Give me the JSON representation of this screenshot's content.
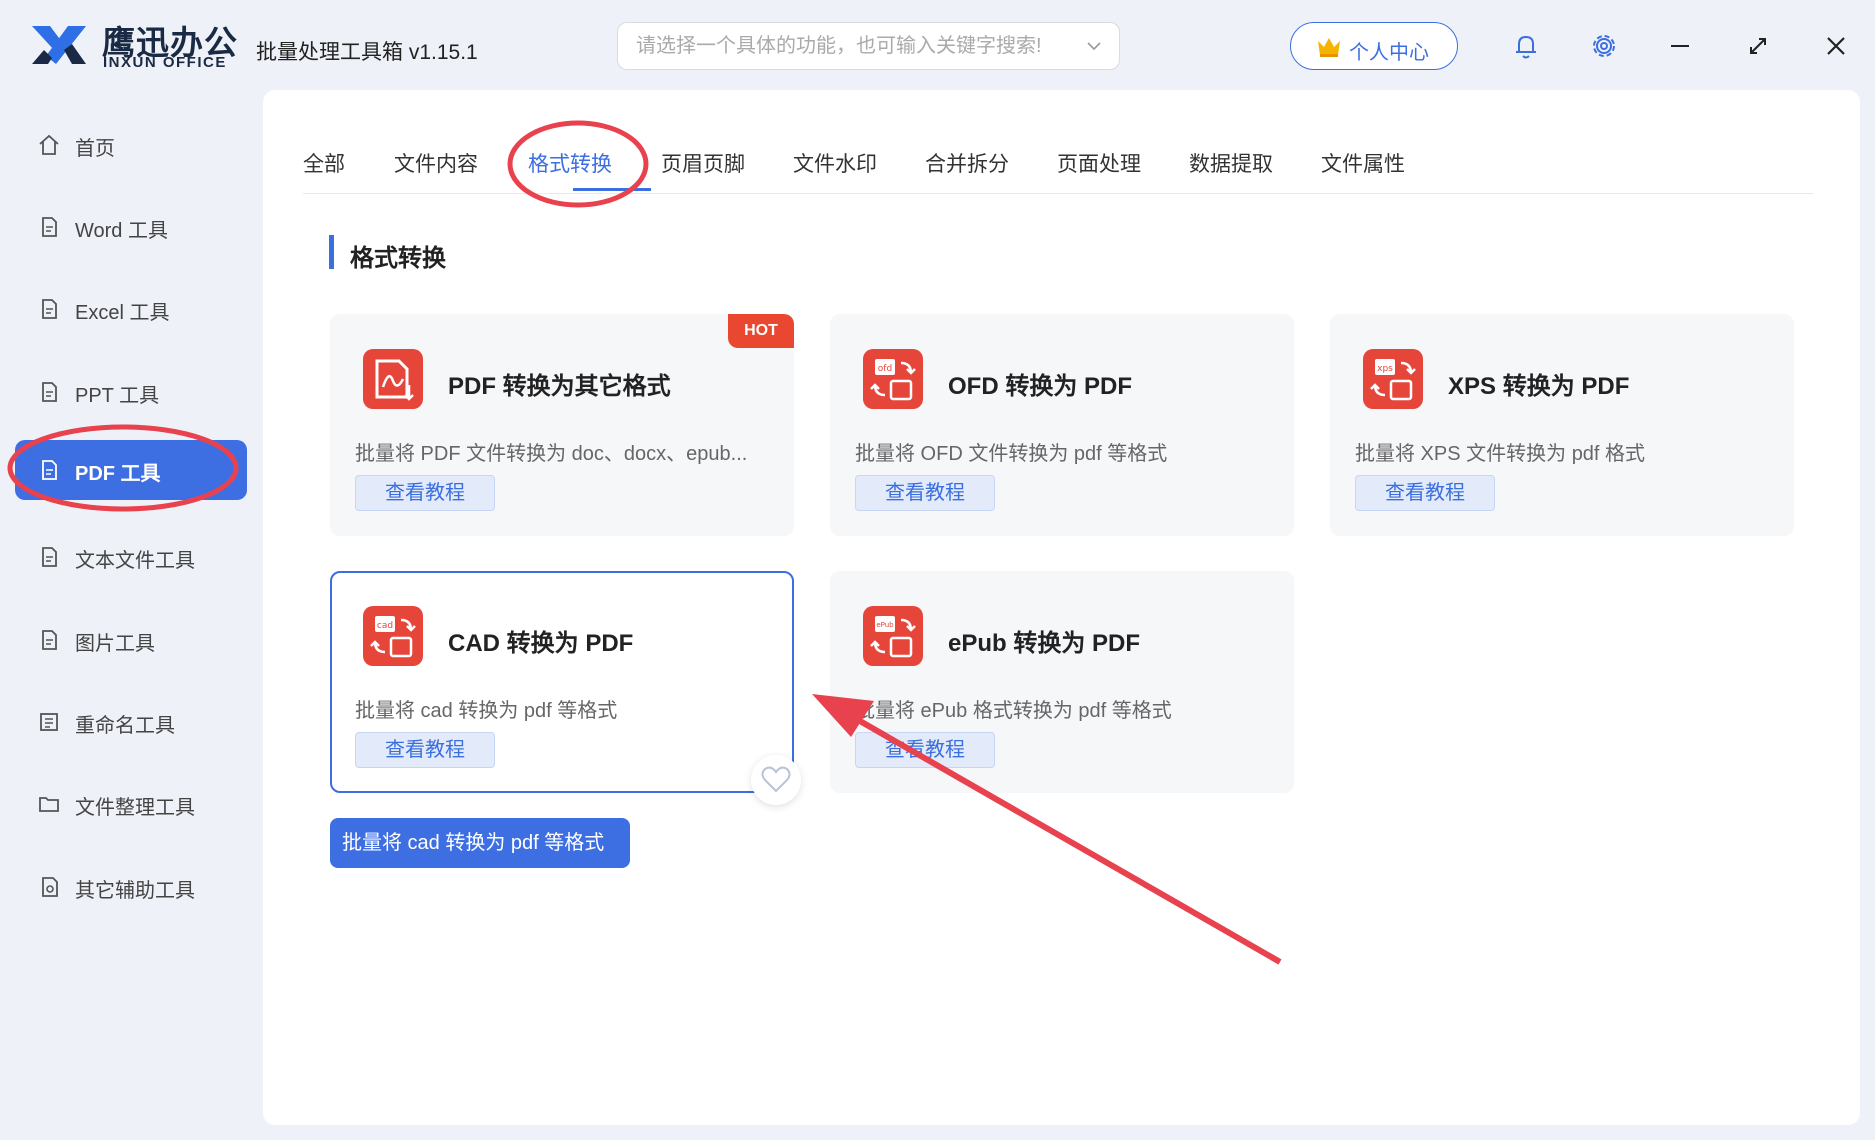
{
  "titlebar": {
    "brand_cn": "鹰迅办公",
    "brand_en": "INXUN OFFICE",
    "app_title": "批量处理工具箱 v1.15.1",
    "search_placeholder": "请选择一个具体的功能，也可输入关键字搜索!",
    "user_center": "个人中心",
    "icons": [
      "bell-icon",
      "gear-icon",
      "minimize-icon",
      "maximize-icon",
      "close-icon"
    ]
  },
  "sidebar": {
    "items": [
      {
        "label": "首页",
        "icon": "home-icon"
      },
      {
        "label": "Word 工具",
        "icon": "word-file-icon"
      },
      {
        "label": "Excel 工具",
        "icon": "excel-file-icon"
      },
      {
        "label": "PPT 工具",
        "icon": "ppt-file-icon"
      },
      {
        "label": "PDF 工具",
        "icon": "pdf-file-icon",
        "active": true
      },
      {
        "label": "文本文件工具",
        "icon": "text-file-icon"
      },
      {
        "label": "图片工具",
        "icon": "image-file-icon"
      },
      {
        "label": "重命名工具",
        "icon": "rename-icon"
      },
      {
        "label": "文件整理工具",
        "icon": "folder-icon"
      },
      {
        "label": "其它辅助工具",
        "icon": "tools-icon"
      }
    ]
  },
  "tabs": [
    {
      "label": "全部"
    },
    {
      "label": "文件内容"
    },
    {
      "label": "格式转换",
      "active": true
    },
    {
      "label": "页眉页脚"
    },
    {
      "label": "文件水印"
    },
    {
      "label": "合并拆分"
    },
    {
      "label": "页面处理"
    },
    {
      "label": "数据提取"
    },
    {
      "label": "文件属性"
    }
  ],
  "section_title": "格式转换",
  "cards": [
    {
      "title": "PDF 转换为其它格式",
      "desc": "批量将 PDF 文件转换为 doc、docx、epub...",
      "button": "查看教程",
      "badge": "HOT",
      "icon": "pdf-convert-icon"
    },
    {
      "title": "OFD 转换为 PDF",
      "desc": "批量将 OFD 文件转换为 pdf 等格式",
      "button": "查看教程",
      "icon": "ofd-convert-icon",
      "icon_text": "ofd"
    },
    {
      "title": "XPS 转换为 PDF",
      "desc": "批量将 XPS 文件转换为 pdf 格式",
      "button": "查看教程",
      "icon": "xps-convert-icon",
      "icon_text": "xps"
    },
    {
      "title": "CAD 转换为 PDF",
      "desc": "批量将 cad 转换为 pdf 等格式",
      "button": "查看教程",
      "icon": "cad-convert-icon",
      "icon_text": "cad"
    },
    {
      "title": "ePub 转换为 PDF",
      "desc": "批量将 ePub 格式转换为 pdf 等格式",
      "button": "查看教程",
      "icon": "epub-convert-icon",
      "icon_text": "ePub"
    }
  ],
  "tooltip": "批量将 cad 转换为 pdf 等格式",
  "colors": {
    "accent": "#3b6fe0",
    "hot": "#e9472f",
    "annotation": "#e8424e"
  }
}
